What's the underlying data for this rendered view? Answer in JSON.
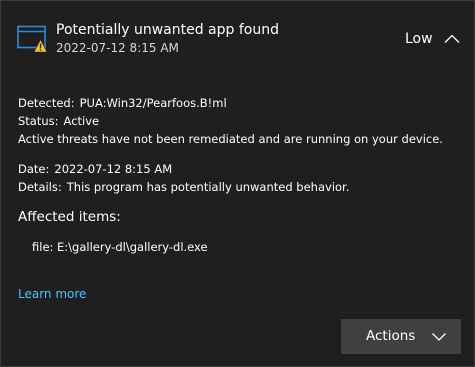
{
  "notification": {
    "title": "Potentially unwanted app found",
    "timestamp": "2022-07-12 8:15 AM",
    "severity": "Low",
    "app_icon": "defender-warning-window-icon",
    "collapse_icon": "chevron-up-icon"
  },
  "details": {
    "detected_label": "Detected:",
    "detected_value": "PUA:Win32/Pearfoos.B!ml",
    "status_label": "Status:",
    "status_value": "Active",
    "status_message": "Active threats have not been remediated and are running on your device.",
    "date_label": "Date:",
    "date_value": "2022-07-12 8:15 AM",
    "details_label": "Details:",
    "details_value": "This program has potentially unwanted behavior."
  },
  "affected": {
    "heading": "Affected items:",
    "items": [
      "file: E:\\gallery-dl\\gallery-dl.exe"
    ]
  },
  "links": {
    "learn_more": "Learn more"
  },
  "actions": {
    "label": "Actions",
    "icon": "chevron-down-icon"
  },
  "colors": {
    "background": "#1f1f1f",
    "border": "#3a3a3a",
    "link": "#4cc2ff",
    "button": "#404040",
    "icon_blue": "#2b8cde",
    "warning_yellow": "#f5c518"
  }
}
